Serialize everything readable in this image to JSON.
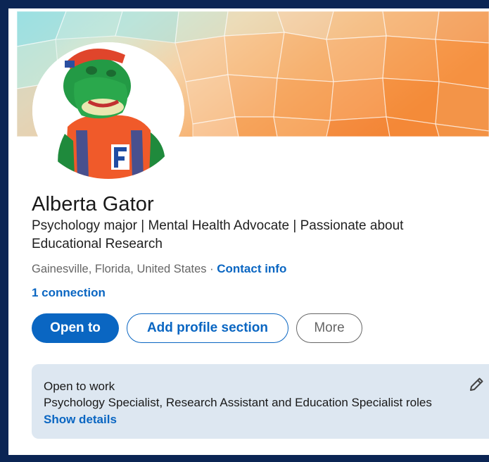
{
  "profile": {
    "name": "Alberta Gator",
    "headline": "Psychology major | Mental Health Advocate | Passionate about Educational Research",
    "location": "Gainesville, Florida, United States",
    "separator": " · ",
    "contact_info": "Contact info",
    "connections": "1 connection"
  },
  "actions": {
    "open_to": "Open to",
    "add_profile_section": "Add profile section",
    "more": "More"
  },
  "open_to_work": {
    "title": "Open to work",
    "roles": "Psychology Specialist, Research Assistant and Education Specialist roles",
    "link": "Show details",
    "edit_icon": "pencil-icon"
  },
  "colors": {
    "frame": "#0b2554",
    "link_blue": "#0a66c2",
    "open_to_work_bg": "#dde7f1",
    "banner_orange": "#f7a14b",
    "banner_teal": "#9ee0e3"
  }
}
